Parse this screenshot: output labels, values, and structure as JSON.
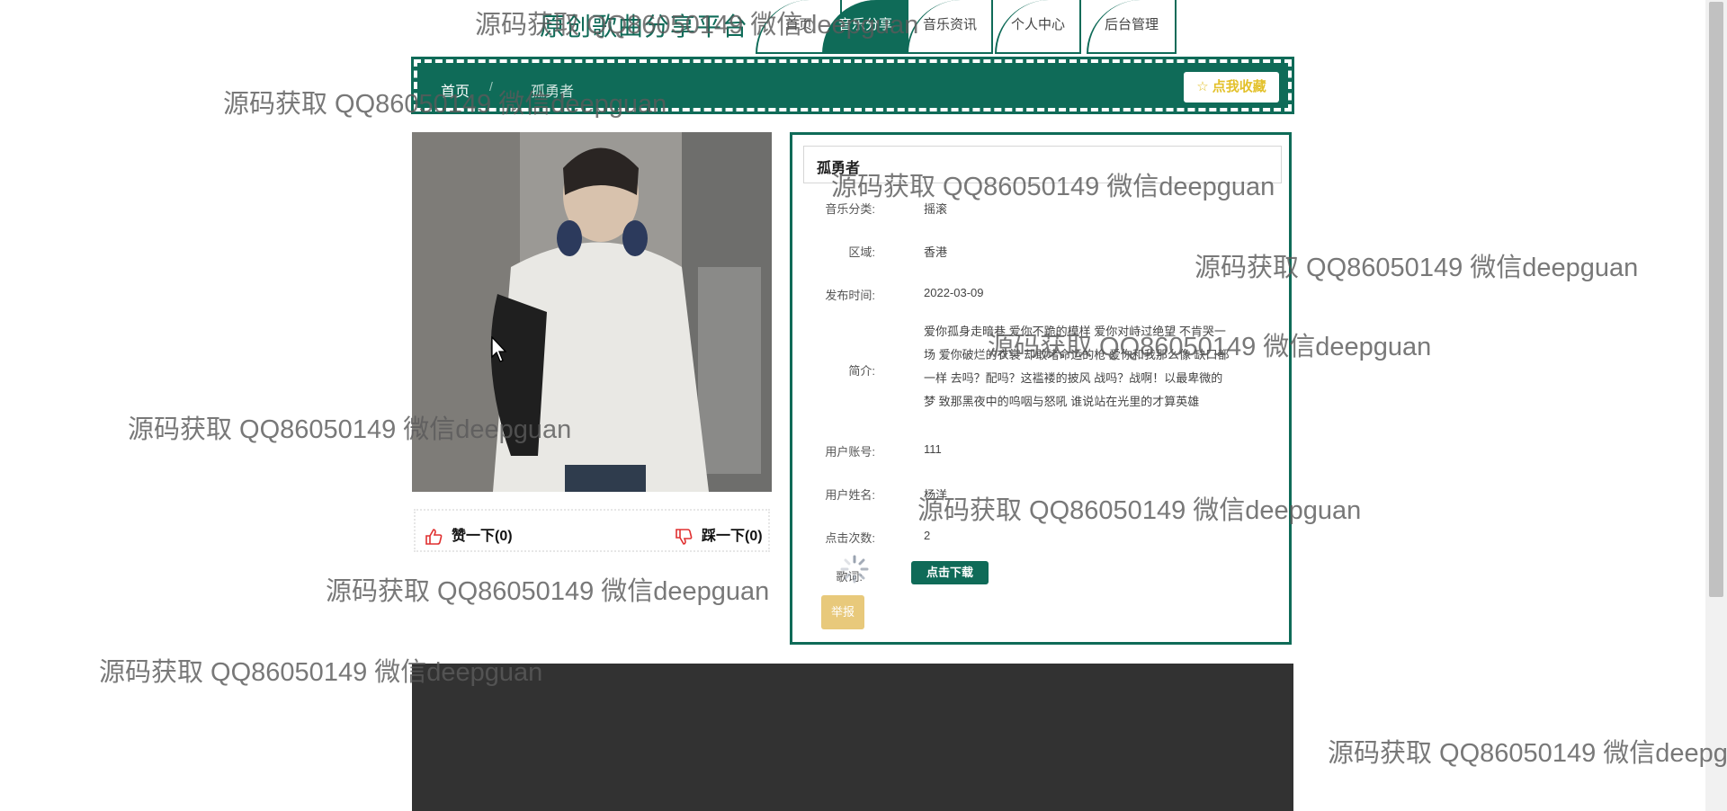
{
  "header": {
    "site_title": "原创歌曲分享平台",
    "nav": [
      "首页",
      "音乐分享",
      "音乐资讯",
      "个人中心",
      "后台管理"
    ],
    "active_index": 1
  },
  "breadcrumb": {
    "home": "首页",
    "separator": "/",
    "current": "孤勇者",
    "favorite_label": "☆ 点我收藏"
  },
  "votes": {
    "like_label": "赞一下(0)",
    "dislike_label": "踩一下(0)"
  },
  "detail": {
    "title": "孤勇者",
    "category_label": "音乐分类:",
    "category": "摇滚",
    "region_label": "区域:",
    "region": "香港",
    "release_label": "发布时间:",
    "release_date": "2022-03-09",
    "intro_label": "简介:",
    "intro_lines": [
      "爱你孤身走暗巷 爱你不跪的模样 爱你对峙过绝望 不肯哭一",
      "场 爱你破烂的衣裳 却敢堵命运的枪 爱你和我那么像 缺口都",
      "一样 去吗？配吗？这褴褛的披风 战吗？战啊！以最卑微的",
      "梦 致那黑夜中的呜咽与怒吼 谁说站在光里的才算英雄"
    ],
    "account_label": "用户账号:",
    "account": "111",
    "username_label": "用户姓名:",
    "username": "杨洋",
    "clicks_label": "点击次数:",
    "clicks": "2",
    "lyrics_label": "歌词:",
    "download_label": "点击下载",
    "report_label": "举报"
  },
  "watermark": "源码获取 QQ86050149 微信deepguan",
  "colors": {
    "brand": "#0f6b58",
    "favorite_text": "#e3c12b",
    "report_bg": "#e8c97b",
    "dark_block": "#323232"
  }
}
